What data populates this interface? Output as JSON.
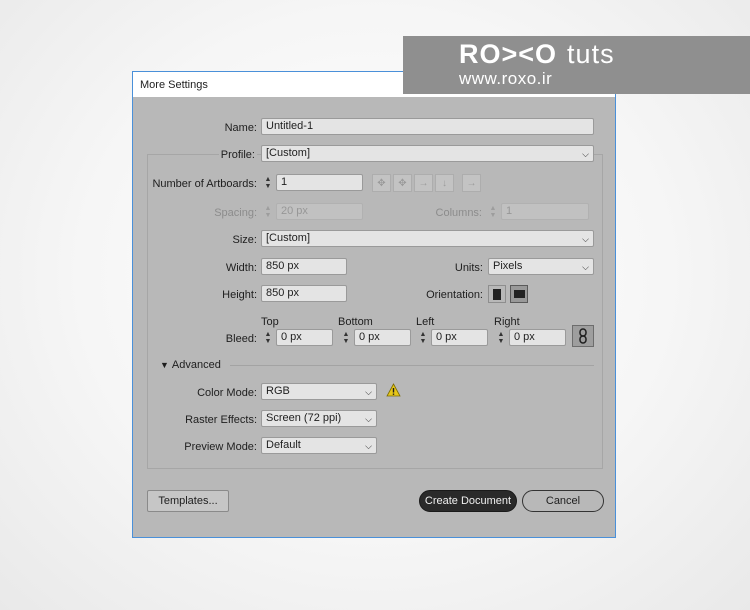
{
  "watermark": {
    "brand": "RO><O",
    "brand_suffix": "tuts",
    "url": "www.roxo.ir"
  },
  "dialog": {
    "title": "More Settings",
    "name": {
      "label": "Name:",
      "value": "Untitled-1"
    },
    "profile": {
      "label": "Profile:",
      "value": "[Custom]"
    },
    "artboards": {
      "label": "Number of Artboards:",
      "value": "1"
    },
    "spacing": {
      "label": "Spacing:",
      "value": "20 px"
    },
    "columns": {
      "label": "Columns:",
      "value": "1"
    },
    "size": {
      "label": "Size:",
      "value": "[Custom]"
    },
    "width": {
      "label": "Width:",
      "value": "850 px"
    },
    "units": {
      "label": "Units:",
      "value": "Pixels"
    },
    "height": {
      "label": "Height:",
      "value": "850 px"
    },
    "orientation": {
      "label": "Orientation:",
      "selected": "landscape"
    },
    "bleed": {
      "label": "Bleed:",
      "top": {
        "label": "Top",
        "value": "0 px"
      },
      "bottom": {
        "label": "Bottom",
        "value": "0 px"
      },
      "left": {
        "label": "Left",
        "value": "0 px"
      },
      "right": {
        "label": "Right",
        "value": "0 px"
      }
    },
    "advanced": {
      "label": "Advanced",
      "expanded": true
    },
    "color_mode": {
      "label": "Color Mode:",
      "value": "RGB"
    },
    "raster_effects": {
      "label": "Raster Effects:",
      "value": "Screen (72 ppi)"
    },
    "preview_mode": {
      "label": "Preview Mode:",
      "value": "Default"
    },
    "buttons": {
      "templates": "Templates...",
      "create": "Create Document",
      "cancel": "Cancel"
    }
  },
  "icons": {
    "spinner": "stepper-icon",
    "dropdown": "chevron-down-icon",
    "warning": "warning-icon",
    "link": "chain-link-icon",
    "portrait": "portrait-icon",
    "landscape": "landscape-icon"
  },
  "colors": {
    "dialog_bg": "#b8b8b8",
    "accent_border": "#4a90d9",
    "warning": "#e6c619",
    "primary_btn": "#2a2a2a"
  }
}
